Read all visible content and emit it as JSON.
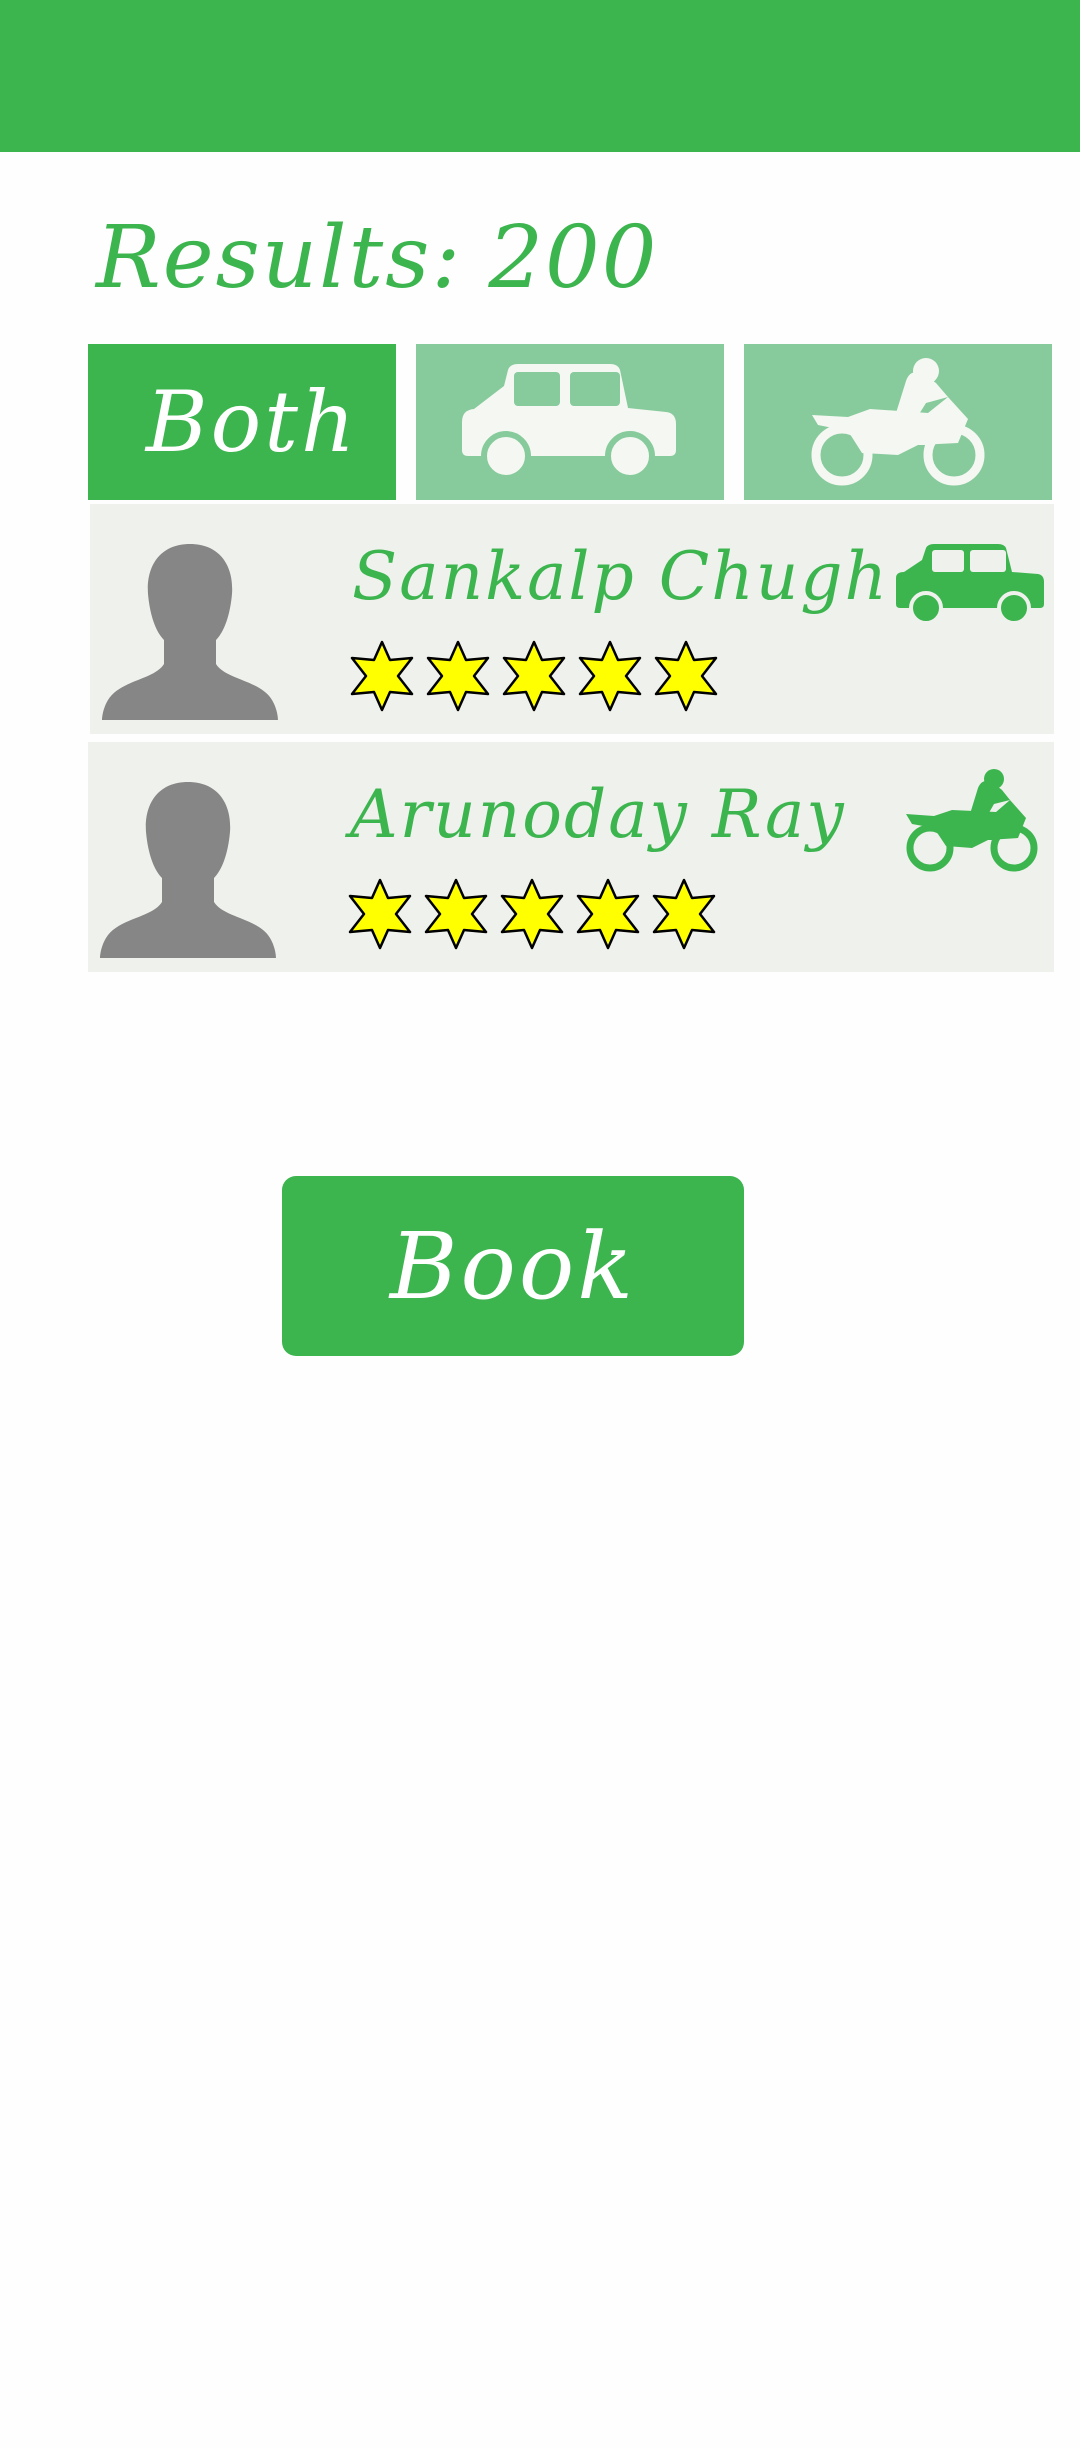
{
  "header": {
    "color": "#3cb54f"
  },
  "results": {
    "label": "Results:",
    "count": "200"
  },
  "filters": {
    "both_label": "Both",
    "car_icon": "car-icon",
    "bike_icon": "motorcycle-icon",
    "selected": "Both"
  },
  "drivers": [
    {
      "name": "Sankalp Chugh",
      "rating": 5,
      "vehicle": "car-icon",
      "avatar": "person-silhouette-icon"
    },
    {
      "name": "Arunoday Ray",
      "rating": 5,
      "vehicle": "motorcycle-icon",
      "avatar": "person-silhouette-icon"
    }
  ],
  "book_button": {
    "label": "Book"
  },
  "colors": {
    "accent": "#3cb54f",
    "tab_inactive": "#87cb9c",
    "card_bg": "#eff1ec",
    "avatar": "#868686",
    "star_fill": "#ffff00"
  }
}
